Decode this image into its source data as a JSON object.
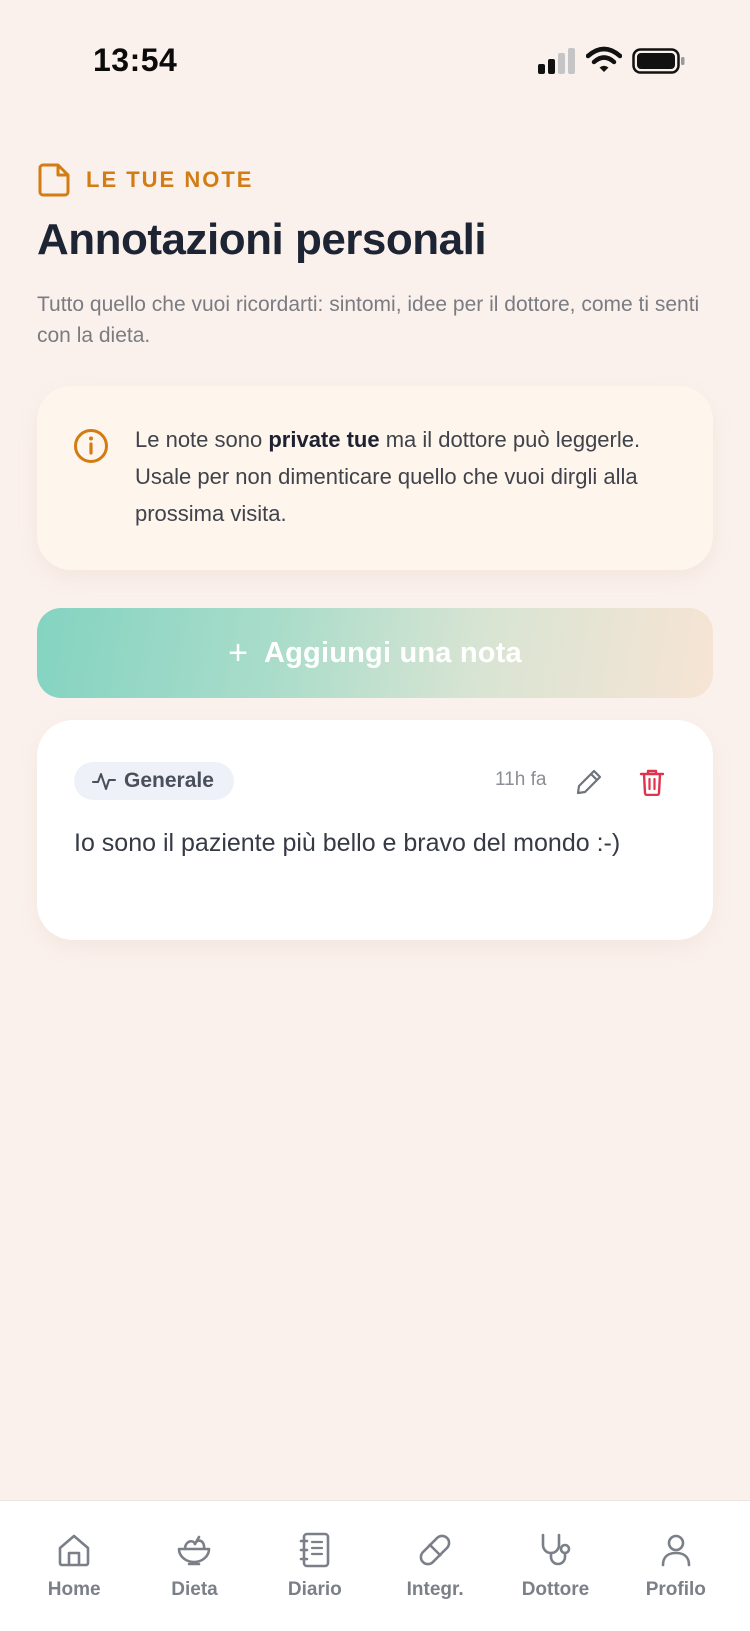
{
  "status_bar": {
    "time": "13:54"
  },
  "header": {
    "eyebrow": "LE TUE NOTE",
    "title": "Annotazioni personali",
    "subtitle": "Tutto quello che vuoi ricordarti: sintomi, idee per il dottore, come ti senti con la dieta."
  },
  "info": {
    "prefix": "Le note sono ",
    "bold": "private tue",
    "suffix": " ma il dottore può leggerle. Usale per non dimenticare quello che vuoi dirgli alla prossima visita."
  },
  "add_button": {
    "plus": "+",
    "label": "Aggiungi una nota"
  },
  "notes": [
    {
      "tag": "Generale",
      "time": "11h fa",
      "text": "Io sono il paziente più bello e bravo del mondo :-)"
    }
  ],
  "nav": [
    {
      "label": "Home",
      "icon": "home-icon"
    },
    {
      "label": "Dieta",
      "icon": "salad-bowl-icon"
    },
    {
      "label": "Diario",
      "icon": "notebook-icon"
    },
    {
      "label": "Integr.",
      "icon": "pill-icon"
    },
    {
      "label": "Dottore",
      "icon": "stethoscope-icon"
    },
    {
      "label": "Profilo",
      "icon": "user-icon"
    }
  ],
  "colors": {
    "background": "#fbf1ec",
    "accent_orange": "#d37c14",
    "delete_red": "#e0334d",
    "nav_gray": "#7b7f88",
    "gradient_start": "#84d3c1",
    "gradient_end": "#f7e4d4"
  }
}
